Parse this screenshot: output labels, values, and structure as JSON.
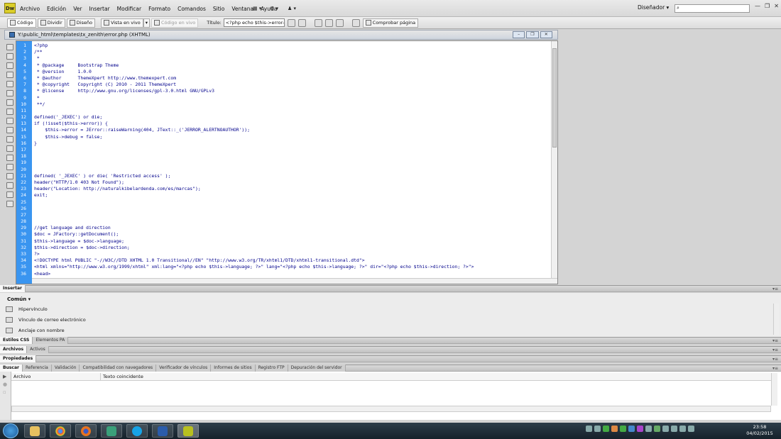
{
  "app": {
    "logo": "Dw"
  },
  "menubar": {
    "items": [
      "Archivo",
      "Edición",
      "Ver",
      "Insertar",
      "Modificar",
      "Formato",
      "Comandos",
      "Sitio",
      "Ventana",
      "Ayuda"
    ],
    "workspace": "Diseñador",
    "search_placeholder": ""
  },
  "doc_toolbar": {
    "code": "Código",
    "split": "Dividir",
    "design": "Diseño",
    "live": "Vista en vivo",
    "live_code": "Código en vivo",
    "title_label": "Título:",
    "title_value": "<?php echo $this->error->get",
    "check_page": "Comprobar página"
  },
  "document": {
    "title": "Y:\\public_html\\templates\\tx_zenith\\error.php (XHTML)",
    "lines": [
      {
        "n": "1",
        "t": "<?php",
        "c": "tag"
      },
      {
        "n": "2",
        "t": "/**",
        "c": "com"
      },
      {
        "n": "3",
        "t": " *",
        "c": "com"
      },
      {
        "n": "4",
        "t": " * @package     Bootstrap Theme",
        "c": "com"
      },
      {
        "n": "5",
        "t": " * @version     1.0.0",
        "c": "com"
      },
      {
        "n": "6",
        "t": " * @author      ThemeXpert http://www.themexpert.com",
        "c": "com"
      },
      {
        "n": "7",
        "t": " * @copyright   Copyright (C) 2010 - 2011 ThemeXpert",
        "c": "com"
      },
      {
        "n": "8",
        "t": " * @license     http://www.gnu.org/licenses/gpl-3.0.html GNU/GPLv3",
        "c": "com"
      },
      {
        "n": "9",
        "t": " *",
        "c": "com"
      },
      {
        "n": "10",
        "t": " **/",
        "c": "com"
      },
      {
        "n": "11",
        "t": "",
        "c": "kw"
      },
      {
        "n": "12",
        "t": "defined('_JEXEC') or die;",
        "c": "kw"
      },
      {
        "n": "13",
        "t": "if (!isset($this->error)) {",
        "c": "kw"
      },
      {
        "n": "14",
        "t": "    $this->error = JError::raiseWarning(404, JText::_('JERROR_ALERTNOAUTHOR'));",
        "c": "kw"
      },
      {
        "n": "15",
        "t": "    $this->debug = false;",
        "c": "kw"
      },
      {
        "n": "16",
        "t": "}",
        "c": "kw"
      },
      {
        "n": "17",
        "t": "",
        "c": "kw"
      },
      {
        "n": "18",
        "t": "",
        "c": "kw"
      },
      {
        "n": "19",
        "t": "",
        "c": "kw"
      },
      {
        "n": "20",
        "t": "",
        "c": "kw"
      },
      {
        "n": "21",
        "t": "defined( '_JEXEC' ) or die( 'Restricted access' );",
        "c": "kw"
      },
      {
        "n": "22",
        "t": "header(\"HTTP/1.0 403 Not Found\");",
        "c": "kw"
      },
      {
        "n": "23",
        "t": "header(\"Location: http://naturalkibelardenda.com/es/marcas\");",
        "c": "kw"
      },
      {
        "n": "24",
        "t": "exit;",
        "c": "kw"
      },
      {
        "n": "25",
        "t": "",
        "c": "kw"
      },
      {
        "n": "26",
        "t": "",
        "c": "kw"
      },
      {
        "n": "27",
        "t": "",
        "c": "kw"
      },
      {
        "n": "28",
        "t": "",
        "c": "kw"
      },
      {
        "n": "29",
        "t": "//get language and direction",
        "c": "com"
      },
      {
        "n": "30",
        "t": "$doc = JFactory::getDocument();",
        "c": "kw"
      },
      {
        "n": "31",
        "t": "$this->language = $doc->language;",
        "c": "kw"
      },
      {
        "n": "32",
        "t": "$this->direction = $doc->direction;",
        "c": "kw"
      },
      {
        "n": "33",
        "t": "?>",
        "c": "tag"
      },
      {
        "n": "34",
        "t": "<!DOCTYPE html PUBLIC \"-//W3C//DTD XHTML 1.0 Transitional//EN\" \"http://www.w3.org/TR/xhtml1/DTD/xhtml1-transitional.dtd\">",
        "c": "kw"
      },
      {
        "n": "35",
        "t": "<html xmlns=\"http://www.w3.org/1999/xhtml\" xml:lang=\"<?php echo $this->language; ?>\" lang=\"<?php echo $this->language; ?>\" dir=\"<?php echo $this->direction; ?>\">",
        "c": "kw"
      },
      {
        "n": "36",
        "t": "<head>",
        "c": "kw"
      }
    ]
  },
  "insert_panel": {
    "tab": "Insertar",
    "category": "Común",
    "items": [
      "Hipervínculo",
      "Vínculo de correo electrónico",
      "Anclaje con nombre"
    ]
  },
  "css_panel": {
    "tabs": [
      "Estilos CSS",
      "Elementos PA"
    ]
  },
  "files_panel": {
    "tabs": [
      "Archivos",
      "Activos"
    ]
  },
  "props_panel": {
    "tab": "Propiedades"
  },
  "results_panel": {
    "tabs": [
      "Buscar",
      "Referencia",
      "Validación",
      "Compatibilidad con navegadores",
      "Verificador de vínculos",
      "Informes de sitios",
      "Registro FTP",
      "Depuración del servidor"
    ],
    "columns": [
      "Archivo",
      "Texto coincidente"
    ]
  },
  "taskbar": {
    "time": "23:58",
    "date": "04/02/2015"
  },
  "colors": {
    "gutter": "#3a95f0",
    "tag": "#cc0000",
    "comment": "#f0a000",
    "code": "#00008b"
  }
}
